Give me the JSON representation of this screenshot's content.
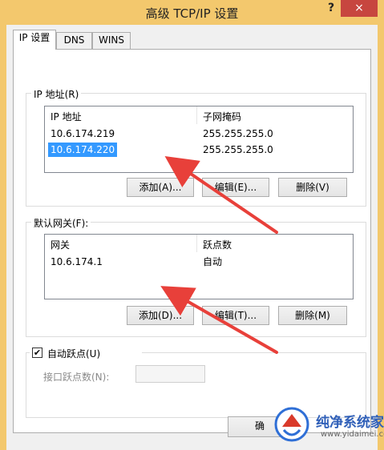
{
  "window": {
    "title": "高级 TCP/IP 设置",
    "help": "?",
    "close": "×"
  },
  "tabs": [
    {
      "label": "IP 设置"
    },
    {
      "label": "DNS"
    },
    {
      "label": "WINS"
    }
  ],
  "ip_group": {
    "legend": "IP 地址(R)",
    "columns": [
      "IP 地址",
      "子网掩码"
    ],
    "rows": [
      {
        "ip": "10.6.174.219",
        "mask": "255.255.255.0"
      },
      {
        "ip": "10.6.174.220",
        "mask": "255.255.255.0"
      }
    ],
    "add": "添加(A)...",
    "edit": "编辑(E)...",
    "delete": "删除(V)"
  },
  "gw_group": {
    "legend": "默认网关(F):",
    "columns": [
      "网关",
      "跃点数"
    ],
    "rows": [
      {
        "gateway": "10.6.174.1",
        "metric": "自动"
      }
    ],
    "add": "添加(D)...",
    "edit": "编辑(T)...",
    "delete": "删除(M)"
  },
  "metric": {
    "auto_label": "自动跃点(U)",
    "auto_checked": true,
    "check_glyph": "✔",
    "interface_label": "接口跃点数(N):",
    "interface_value": ""
  },
  "footer": {
    "ok_partial": "确"
  },
  "watermark": {
    "site_name": "纯净系统家园",
    "url": "www.yidaimei.com"
  },
  "colors": {
    "titlebar": "#f3c86d",
    "close_button": "#c7463f",
    "selection": "#3399ff",
    "arrow": "#e8403a"
  }
}
